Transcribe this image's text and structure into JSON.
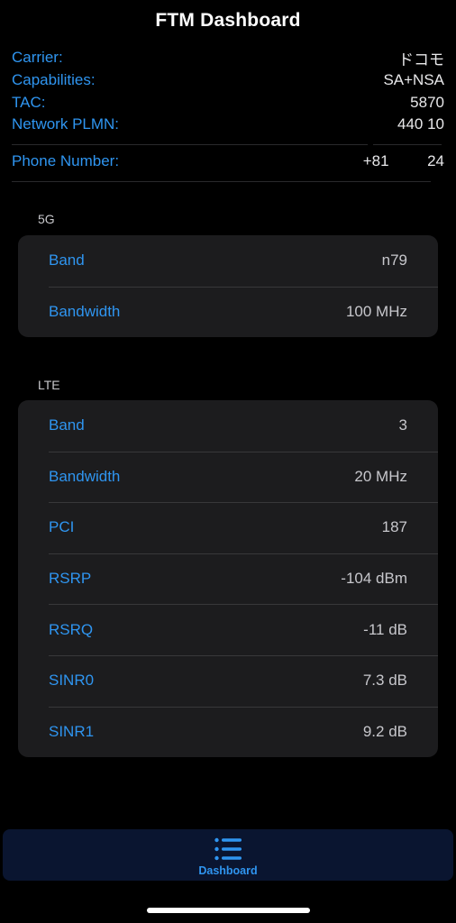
{
  "title": "FTM Dashboard",
  "info": [
    {
      "label": "Carrier:",
      "value": "ドコモ"
    },
    {
      "label": "Capabilities:",
      "value": "SA+NSA"
    },
    {
      "label": "TAC:",
      "value": "5870"
    },
    {
      "label": "Network PLMN:",
      "value": "440 10"
    },
    {
      "label": "Phone Number:",
      "value": "+81         24"
    }
  ],
  "sections": {
    "nr": {
      "header": "5G",
      "rows": [
        {
          "label": "Band",
          "value": "n79"
        },
        {
          "label": "Bandwidth",
          "value": "100 MHz"
        }
      ]
    },
    "lte": {
      "header": "LTE",
      "rows": [
        {
          "label": "Band",
          "value": "3"
        },
        {
          "label": "Bandwidth",
          "value": "20 MHz"
        },
        {
          "label": "PCI",
          "value": "187"
        },
        {
          "label": "RSRP",
          "value": "-104 dBm"
        },
        {
          "label": "RSRQ",
          "value": "-11 dB"
        },
        {
          "label": "SINR0",
          "value": "7.3 dB"
        },
        {
          "label": "SINR1",
          "value": "9.2 dB"
        }
      ]
    }
  },
  "tabbar": {
    "label": "Dashboard",
    "icon": "list-icon"
  },
  "colors": {
    "accent": "#2f95f0",
    "card": "#1c1c1e",
    "background": "#000000"
  }
}
